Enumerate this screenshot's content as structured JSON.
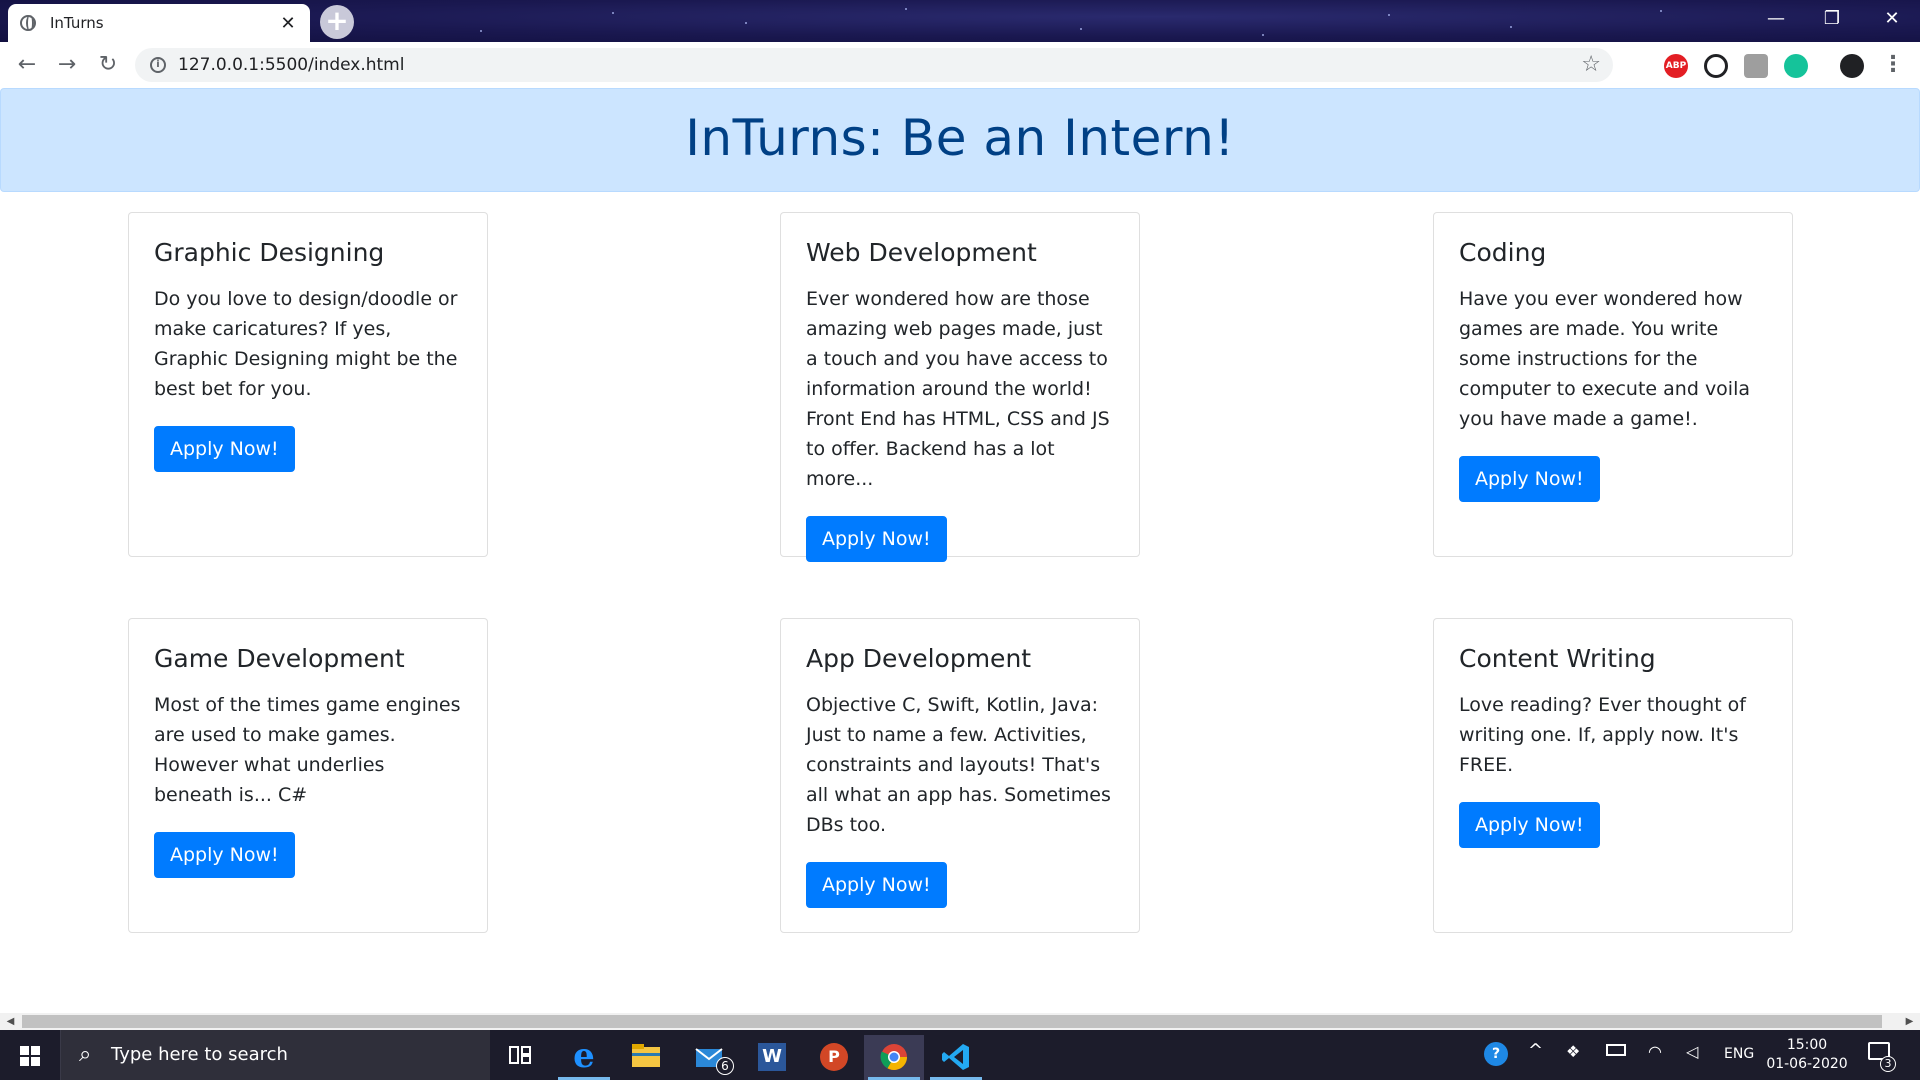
{
  "browser": {
    "tab_title": "InTurns",
    "tab_close": "✕",
    "new_tab": "+",
    "url": "127.0.0.1:5500/index.html",
    "window_controls": {
      "minimize": "—",
      "restore": "❐",
      "close": "✕"
    },
    "extensions": [
      {
        "name": "adblock-icon",
        "label": "ABP",
        "color": "#e31e24"
      },
      {
        "name": "github-icon",
        "label": "",
        "color": "#202124"
      },
      {
        "name": "extension-icon",
        "label": "",
        "color": "#9e9e9e"
      },
      {
        "name": "grammarly-icon",
        "label": "",
        "color": "#15c39a"
      }
    ]
  },
  "page": {
    "heading": "InTurns: Be an Intern!",
    "cards": [
      {
        "title": "Graphic Designing",
        "text": "Do you love to design/doodle or make caricatures? If yes, Graphic Designing might be the best bet for you.",
        "button": "Apply Now!"
      },
      {
        "title": "Web Development",
        "text": "Ever wondered how are those amazing web pages made, just a touch and you have access to information around the world! Front End has HTML, CSS and JS to offer. Backend has a lot more...",
        "button": "Apply Now!"
      },
      {
        "title": "Coding",
        "text": "Have you ever wondered how games are made. You write some instructions for the computer to execute and voila you have made a game!.",
        "button": "Apply Now!"
      },
      {
        "title": "Game Development",
        "text": "Most of the times game engines are used to make games. However what underlies beneath is... C#",
        "button": "Apply Now!"
      },
      {
        "title": "App Development",
        "text": "Objective C, Swift, Kotlin, Java: Just to name a few. Activities, constraints and layouts! That's all what an app has. Sometimes DBs too.",
        "button": "Apply Now!"
      },
      {
        "title": "Content Writing",
        "text": "Love reading? Ever thought of writing one. If, apply now. It's FREE.",
        "button": "Apply Now!"
      }
    ]
  },
  "taskbar": {
    "search_placeholder": "Type here to search",
    "mail_badge": "6",
    "language": "ENG",
    "time": "15:00",
    "date": "01-06-2020",
    "notification_count": "3"
  },
  "colors": {
    "primary": "#007bff",
    "jumbotron_bg": "#cce5ff",
    "jumbotron_text": "#004085"
  }
}
